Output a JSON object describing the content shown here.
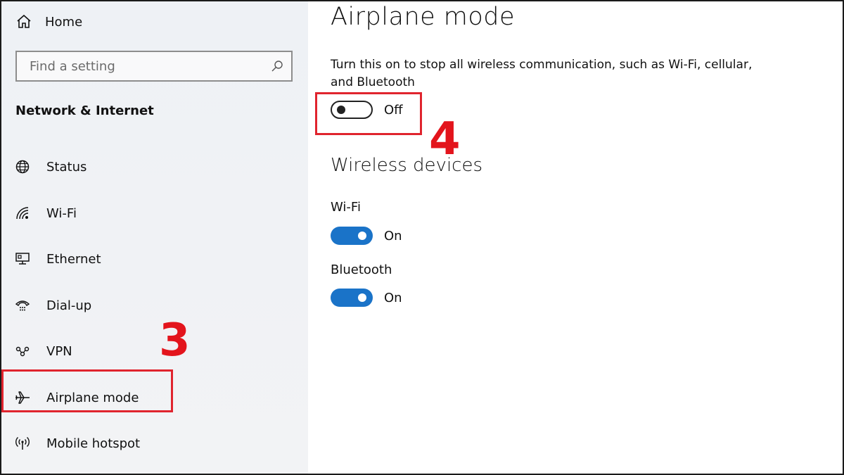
{
  "sidebar": {
    "home_label": "Home",
    "search_placeholder": "Find a setting",
    "section_title": "Network & Internet",
    "items": [
      {
        "label": "Status",
        "icon": "globe-icon"
      },
      {
        "label": "Wi-Fi",
        "icon": "wifi-icon"
      },
      {
        "label": "Ethernet",
        "icon": "ethernet-icon"
      },
      {
        "label": "Dial-up",
        "icon": "dialup-icon"
      },
      {
        "label": "VPN",
        "icon": "vpn-icon"
      },
      {
        "label": "Airplane mode",
        "icon": "airplane-icon"
      },
      {
        "label": "Mobile hotspot",
        "icon": "hotspot-icon"
      }
    ]
  },
  "main": {
    "title": "Airplane mode",
    "description": "Turn this on to stop all wireless communication, such as Wi-Fi, cellular, and Bluetooth",
    "airplane_toggle": {
      "state": "Off",
      "on": false
    },
    "wireless_title": "Wireless devices",
    "devices": [
      {
        "label": "Wi-Fi",
        "state": "On",
        "on": true
      },
      {
        "label": "Bluetooth",
        "state": "On",
        "on": true
      }
    ]
  },
  "annotations": {
    "step3": "3",
    "step4": "4",
    "highlight_color": "#e0242e"
  },
  "colors": {
    "toggle_on": "#1a73c8",
    "sidebar_bg": "#eef1f5"
  }
}
